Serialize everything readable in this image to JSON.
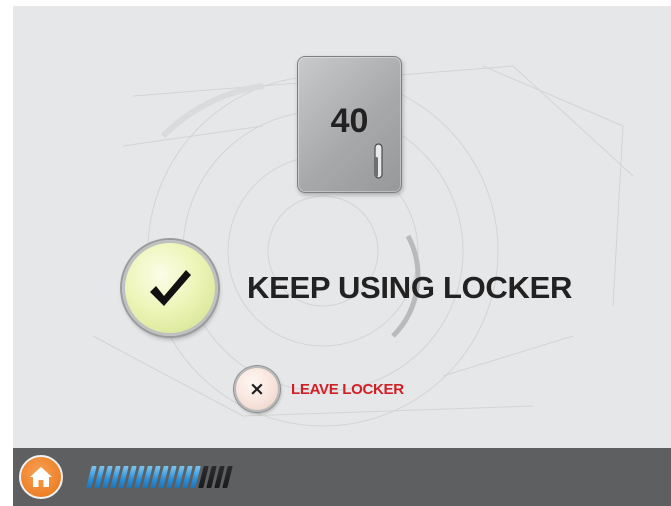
{
  "locker": {
    "number": "40"
  },
  "options": {
    "keep_label": "KEEP USING LOCKER",
    "keep_icon": "checkmark-icon",
    "leave_label": "LEAVE LOCKER",
    "leave_icon": "x-icon",
    "leave_glyph": "×"
  },
  "footer": {
    "home_icon": "home-icon",
    "progress": {
      "filled_segments": 14,
      "total_segments": 18
    }
  },
  "colors": {
    "leave_label": "#d11f26",
    "progress_on": "#2d8fd6",
    "home_button": "#ee8027"
  }
}
